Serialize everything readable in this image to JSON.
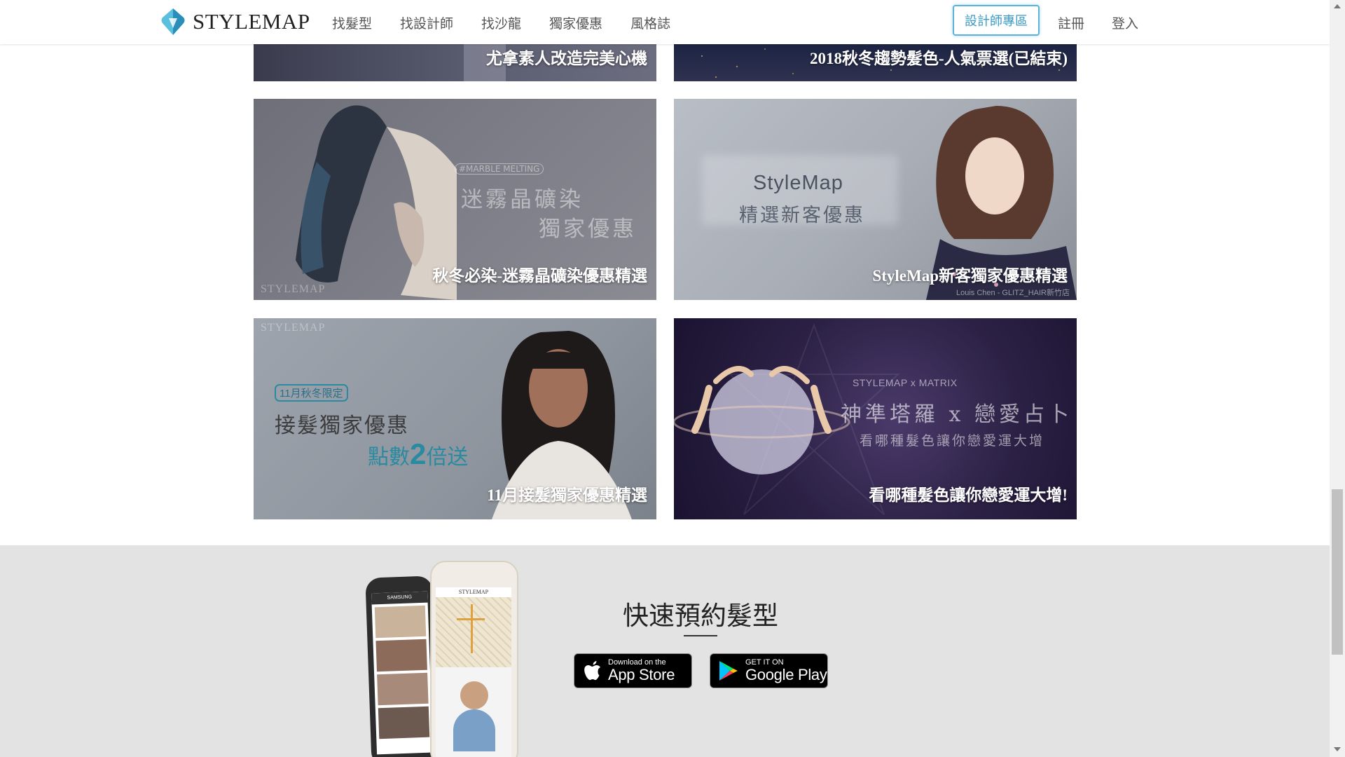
{
  "header": {
    "logo_text": "STYLEMAP",
    "nav": [
      "找髮型",
      "找設計師",
      "找沙龍",
      "獨家優惠",
      "風格誌"
    ],
    "designer_zone": "設計師專區",
    "register": "註冊",
    "login": "登入"
  },
  "cards": {
    "top_left": {
      "caption": "尤拿素人改造完美心機"
    },
    "top_right": {
      "caption": "2018秋冬趨勢髮色-人氣票選(已結束)"
    },
    "c1": {
      "caption": "秋冬必染-迷霧晶礦染優惠精選",
      "tag": "#MARBLE MELTING",
      "line1": "迷霧晶礦染",
      "line2": "獨家優惠",
      "watermark": "STYLEMAP"
    },
    "c2": {
      "caption": "StyleMap新客獨家優惠精選",
      "line1": "StyleMap",
      "line2": "精選新客優惠",
      "credit": "Louis Chen - GLITZ_HAIR新竹店"
    },
    "c3": {
      "caption": "11月接髮獨家優惠精選",
      "watermark": "STYLEMAP",
      "badge": "11月秋冬限定",
      "line1": "接髮獨家優惠",
      "line2a": "點數",
      "line2b": "2",
      "line2c": "倍送"
    },
    "c4": {
      "caption": "看哪種髮色讓你戀愛運大增!",
      "brand": "STYLEMAP x MATRIX",
      "line1": "神準塔羅 x 戀愛占卜",
      "line2": "看哪種髮色讓你戀愛運大增"
    }
  },
  "footer": {
    "title": "快速預約髮型",
    "appstore_small": "Download on the",
    "appstore_big": "App Store",
    "google_small": "GET IT ON",
    "google_big": "Google Play",
    "phone_brand_back": "SAMSUNG",
    "phone_brand_front": "STYLEMAP"
  },
  "colors": {
    "accent": "#5bb3d9",
    "footer_bg": "#e3e3e3"
  }
}
